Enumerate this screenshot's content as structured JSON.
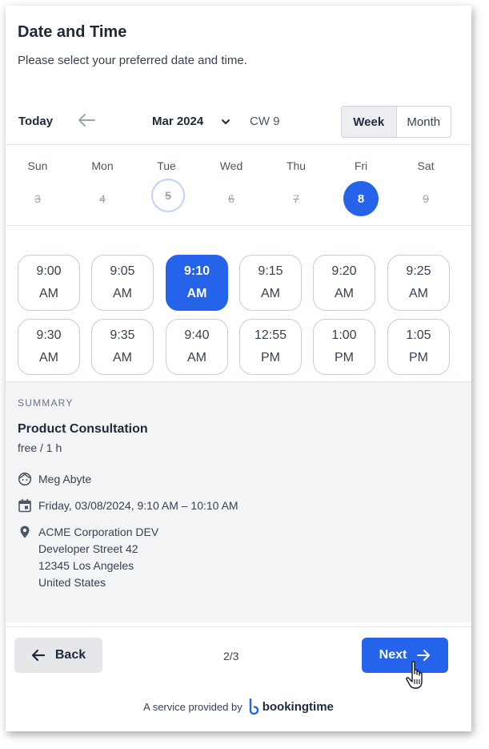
{
  "header": {
    "title": "Date and Time",
    "subtitle": "Please select your preferred date and time."
  },
  "nav": {
    "today_label": "Today",
    "month_label": "Mar 2024",
    "calendar_week": "CW 9",
    "view_toggle": {
      "week": "Week",
      "month": "Month",
      "active": "week"
    }
  },
  "days": [
    {
      "name": "Sun",
      "date": "3",
      "state": "disabled"
    },
    {
      "name": "Mon",
      "date": "4",
      "state": "disabled"
    },
    {
      "name": "Tue",
      "date": "5",
      "state": "today"
    },
    {
      "name": "Wed",
      "date": "6",
      "state": "disabled"
    },
    {
      "name": "Thu",
      "date": "7",
      "state": "disabled"
    },
    {
      "name": "Fri",
      "date": "8",
      "state": "selected"
    },
    {
      "name": "Sat",
      "date": "9",
      "state": "disabled"
    }
  ],
  "slots": [
    {
      "time": "9:00",
      "period": "AM",
      "selected": false
    },
    {
      "time": "9:05",
      "period": "AM",
      "selected": false
    },
    {
      "time": "9:10",
      "period": "AM",
      "selected": true
    },
    {
      "time": "9:15",
      "period": "AM",
      "selected": false
    },
    {
      "time": "9:20",
      "period": "AM",
      "selected": false
    },
    {
      "time": "9:25",
      "period": "AM",
      "selected": false
    },
    {
      "time": "9:30",
      "period": "AM",
      "selected": false
    },
    {
      "time": "9:35",
      "period": "AM",
      "selected": false
    },
    {
      "time": "9:40",
      "period": "AM",
      "selected": false
    },
    {
      "time": "12:55",
      "period": "PM",
      "selected": false
    },
    {
      "time": "1:00",
      "period": "PM",
      "selected": false
    },
    {
      "time": "1:05",
      "period": "PM",
      "selected": false
    }
  ],
  "summary": {
    "label": "SUMMARY",
    "product": "Product Consultation",
    "price_duration": "free / 1 h",
    "staff": "Meg Abyte",
    "datetime": "Friday, 03/08/2024, 9:10 AM – 10:10 AM",
    "address": {
      "line1": "ACME Corporation DEV",
      "line2": "Developer Street 42",
      "line3": "12345 Los Angeles",
      "line4": "United States"
    }
  },
  "footer": {
    "back_label": "Back",
    "step": "2/3",
    "next_label": "Next",
    "provided_by": "A service provided by",
    "brand": "bookingtime"
  },
  "colors": {
    "accent": "#2563eb",
    "today_ring": "#bfd3f6",
    "summary_bg": "#f3f4f6"
  },
  "icons": {
    "prev": "arrow-left-icon",
    "next": "arrow-right-icon",
    "dropdown": "chevron-down-icon",
    "staff": "face-icon",
    "date": "calendar-icon",
    "location": "map-pin-icon"
  }
}
